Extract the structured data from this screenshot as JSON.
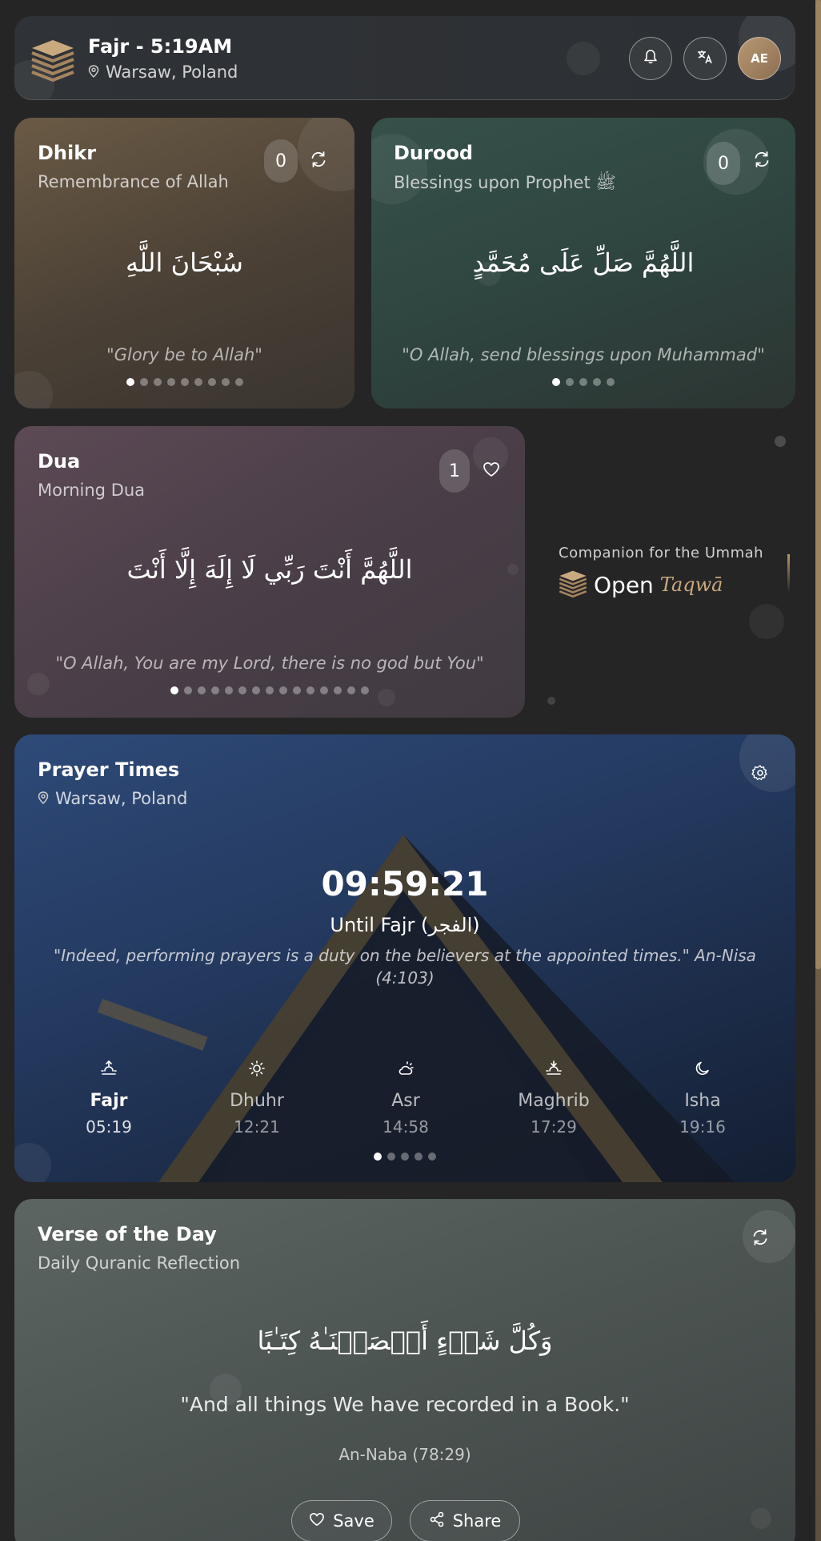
{
  "header": {
    "title": "Fajr - 5:19AM",
    "location": "Warsaw, Poland",
    "avatar_initials": "AE"
  },
  "dhikr": {
    "title": "Dhikr",
    "subtitle": "Remembrance of Allah",
    "count": "0",
    "arabic": "سُبْحَانَ اللَّهِ",
    "translation": "\"Glory be to Allah\"",
    "dot_count": 9,
    "active_dot": 0
  },
  "durood": {
    "title": "Durood",
    "subtitle": "Blessings upon Prophet ﷺ",
    "count": "0",
    "arabic": "اللَّهُمَّ صَلِّ عَلَى مُحَمَّدٍ",
    "translation": "\"O Allah, send blessings upon Muhammad\"",
    "dot_count": 5,
    "active_dot": 0
  },
  "dua": {
    "title": "Dua",
    "subtitle": "Morning Dua",
    "count": "1",
    "arabic": "اللَّهُمَّ أَنْتَ رَبِّي لَا إِلَهَ إِلَّا أَنْتَ",
    "translation": "\"O Allah, You are my Lord, there is no god but You\"",
    "dot_count": 15,
    "active_dot": 0
  },
  "brand": {
    "tagline": "Companion for the Ummah",
    "name_primary": "Open",
    "name_script": "Taqwā"
  },
  "prayer": {
    "title": "Prayer Times",
    "location": "Warsaw, Poland",
    "countdown": "09:59:21",
    "until": "Until Fajr (الفجر)",
    "quote": "\"Indeed, performing prayers is a duty on the believers at the appointed times.\" An-Nisa (4:103)",
    "times": [
      {
        "name": "Fajr",
        "time": "05:19",
        "icon": "sunrise-icon"
      },
      {
        "name": "Dhuhr",
        "time": "12:21",
        "icon": "sun-icon"
      },
      {
        "name": "Asr",
        "time": "14:58",
        "icon": "cloud-sun-icon"
      },
      {
        "name": "Maghrib",
        "time": "17:29",
        "icon": "sunset-icon"
      },
      {
        "name": "Isha",
        "time": "19:16",
        "icon": "moon-icon"
      }
    ],
    "dot_count": 5,
    "active_dot": 0
  },
  "verse": {
    "title": "Verse of the Day",
    "subtitle": "Daily Quranic Reflection",
    "arabic": "وَكُلَّ شَىۡءٍ أَحۡصَيۡنَـٰهُ كِتَـٰبًا",
    "translation": "\"And all things We have recorded in a Book.\"",
    "reference": "An-Naba (78:29)",
    "save_label": "Save",
    "share_label": "Share"
  },
  "colors": {
    "gold": "#b8976b",
    "background": "#252525"
  }
}
